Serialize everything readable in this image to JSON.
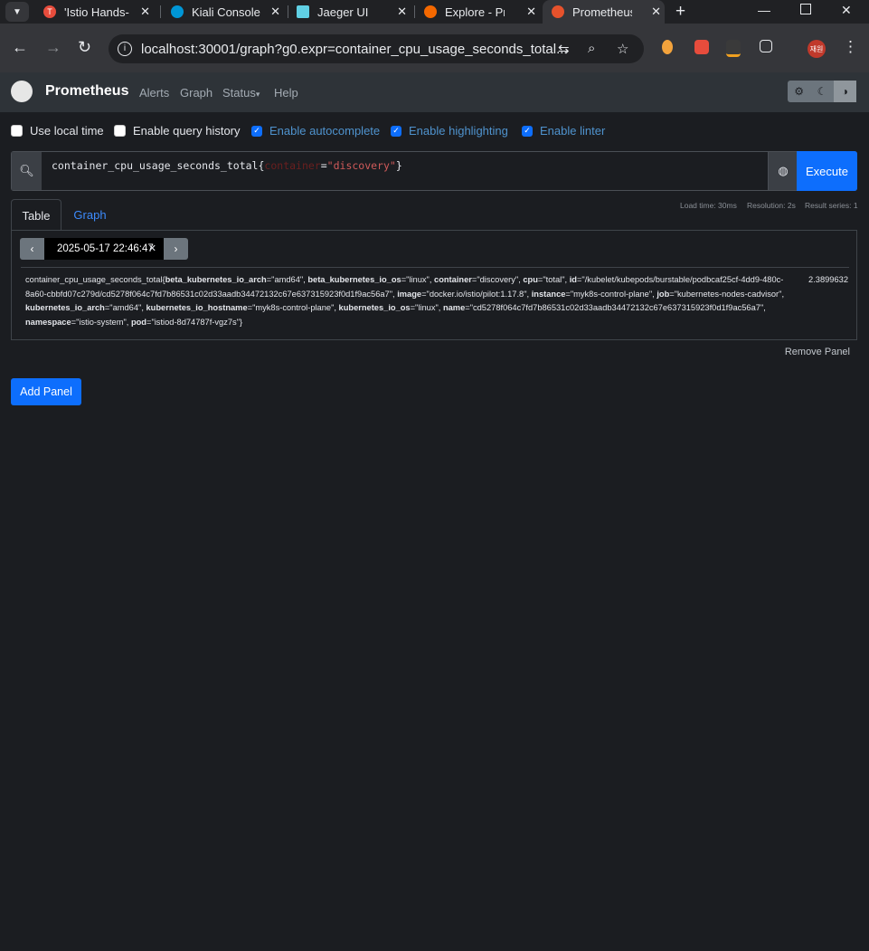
{
  "browser": {
    "tabs": [
      {
        "title": "'Istio Hands-",
        "icon": "istio-hands-icon",
        "color": "#e74c3c"
      },
      {
        "title": "Kiali Console",
        "icon": "kiali-icon",
        "color": "#0096d6"
      },
      {
        "title": "Jaeger UI",
        "icon": "jaeger-icon",
        "color": "#60d0e4"
      },
      {
        "title": "Explore - Pro",
        "icon": "grafana-icon",
        "color": "#f46800"
      },
      {
        "title": "Prometheus",
        "icon": "prometheus-icon",
        "color": "#e6522c"
      }
    ],
    "new_tab": "+",
    "url": "localhost:30001/graph?g0.expr=container_cpu_usage_seconds_total...",
    "profile_initials": "재원"
  },
  "nav": {
    "brand": "Prometheus",
    "links": [
      "Alerts",
      "Graph",
      "Status",
      "Help"
    ],
    "status_caret": "▾",
    "theme_icons": [
      "gear-icon",
      "moon-icon",
      "contrast-icon"
    ]
  },
  "options": [
    {
      "label": "Use local time",
      "checked": false
    },
    {
      "label": "Enable query history",
      "checked": false
    },
    {
      "label": "Enable autocomplete",
      "checked": true
    },
    {
      "label": "Enable highlighting",
      "checked": true
    },
    {
      "label": "Enable linter",
      "checked": true
    }
  ],
  "query": {
    "metric": "container_cpu_usage_seconds_total",
    "open_brace": "{",
    "label": "container",
    "eq": "=",
    "value": "\"discovery\"",
    "close_brace": "}",
    "execute_label": "Execute"
  },
  "stats": {
    "load_time": "Load time: 30ms",
    "resolution": "Resolution: 2s",
    "result_series": "Result series: 1"
  },
  "tabs": {
    "table": "Table",
    "graph": "Graph"
  },
  "table": {
    "time_input": "2025-05-17 22:46:47",
    "metric_name": "container_cpu_usage_seconds_total",
    "labels": [
      {
        "k": "beta_kubernetes_io_arch",
        "v": "\"amd64\""
      },
      {
        "k": "beta_kubernetes_io_os",
        "v": "\"linux\""
      },
      {
        "k": "container",
        "v": "\"discovery\""
      },
      {
        "k": "cpu",
        "v": "\"total\""
      },
      {
        "k": "id",
        "v": "\"/kubelet/kubepods/burstable/podbcaf25cf-4dd9-480c-8a60-cbbfd07c279d/cd5278f064c7fd7b86531c02d33aadb34472132c67e637315923f0d1f9ac56a7\""
      },
      {
        "k": "image",
        "v": "\"docker.io/istio/pilot:1.17.8\""
      },
      {
        "k": "instance",
        "v": "\"myk8s-control-plane\""
      },
      {
        "k": "job",
        "v": "\"kubernetes-nodes-cadvisor\""
      },
      {
        "k": "kubernetes_io_arch",
        "v": "\"amd64\""
      },
      {
        "k": "kubernetes_io_hostname",
        "v": "\"myk8s-control-plane\""
      },
      {
        "k": "kubernetes_io_os",
        "v": "\"linux\""
      },
      {
        "k": "name",
        "v": "\"cd5278f064c7fd7b86531c02d33aadb34472132c67e637315923f0d1f9ac56a7\""
      },
      {
        "k": "namespace",
        "v": "\"istio-system\""
      },
      {
        "k": "pod",
        "v": "\"istiod-8d74787f-vgz7s\""
      }
    ],
    "value": "2.3899632"
  },
  "remove_panel": "Remove Panel",
  "add_panel": "Add Panel"
}
